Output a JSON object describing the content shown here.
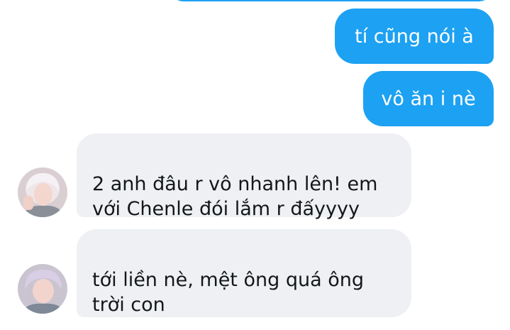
{
  "messages": [
    {
      "direction": "outgoing",
      "text": "tí cũng nói à"
    },
    {
      "direction": "outgoing",
      "text": "vô ăn i nè"
    },
    {
      "direction": "incoming",
      "text": "2 anh đâu r vô nhanh lên! em\nvới Chenle đói lắm r đấyyyy"
    },
    {
      "direction": "incoming",
      "text": "tới liền nè, mệt ông quá ông\ntrời con"
    }
  ],
  "colors": {
    "outgoing_bubble": "#1da1f2",
    "incoming_bubble": "#eef0f3",
    "incoming_text": "#14171a",
    "background": "#ffffff"
  }
}
